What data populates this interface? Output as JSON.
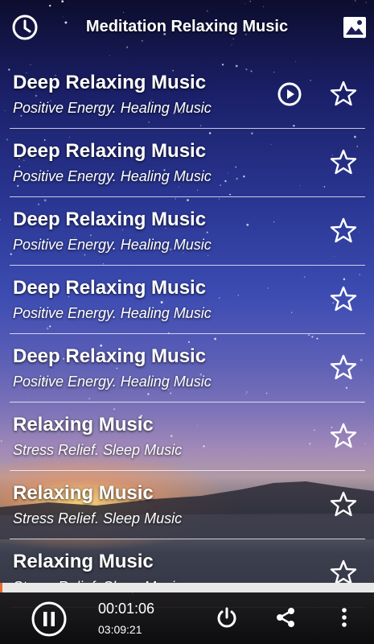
{
  "header": {
    "title": "Meditation Relaxing Music",
    "left_icon": "clock-icon",
    "right_icon": "image-icon"
  },
  "tracks": [
    {
      "title": "Deep Relaxing Music",
      "subtitle": "Positive Energy. Healing Music",
      "playing": true
    },
    {
      "title": "Deep Relaxing Music",
      "subtitle": "Positive Energy. Healing Music",
      "playing": false
    },
    {
      "title": "Deep Relaxing Music",
      "subtitle": "Positive Energy. Healing Music",
      "playing": false
    },
    {
      "title": "Deep Relaxing Music",
      "subtitle": "Positive Energy. Healing Music",
      "playing": false
    },
    {
      "title": "Deep Relaxing Music",
      "subtitle": "Positive Energy. Healing Music",
      "playing": false
    },
    {
      "title": "Relaxing Music",
      "subtitle": "Stress Relief. Sleep Music",
      "playing": false
    },
    {
      "title": "Relaxing Music",
      "subtitle": "Stress Relief. Sleep Music",
      "playing": false
    },
    {
      "title": "Relaxing Music",
      "subtitle": "Stress Relief. Sleep Music",
      "playing": false
    }
  ],
  "player": {
    "current_time": "00:01:06",
    "total_time": "03:09:21",
    "progress_fraction": 0.006,
    "icons": [
      "pause-icon",
      "power-icon",
      "share-icon",
      "more-vertical-icon"
    ]
  },
  "colors": {
    "progress_fill": "#e8692c",
    "progress_track": "#e8e8e8"
  }
}
